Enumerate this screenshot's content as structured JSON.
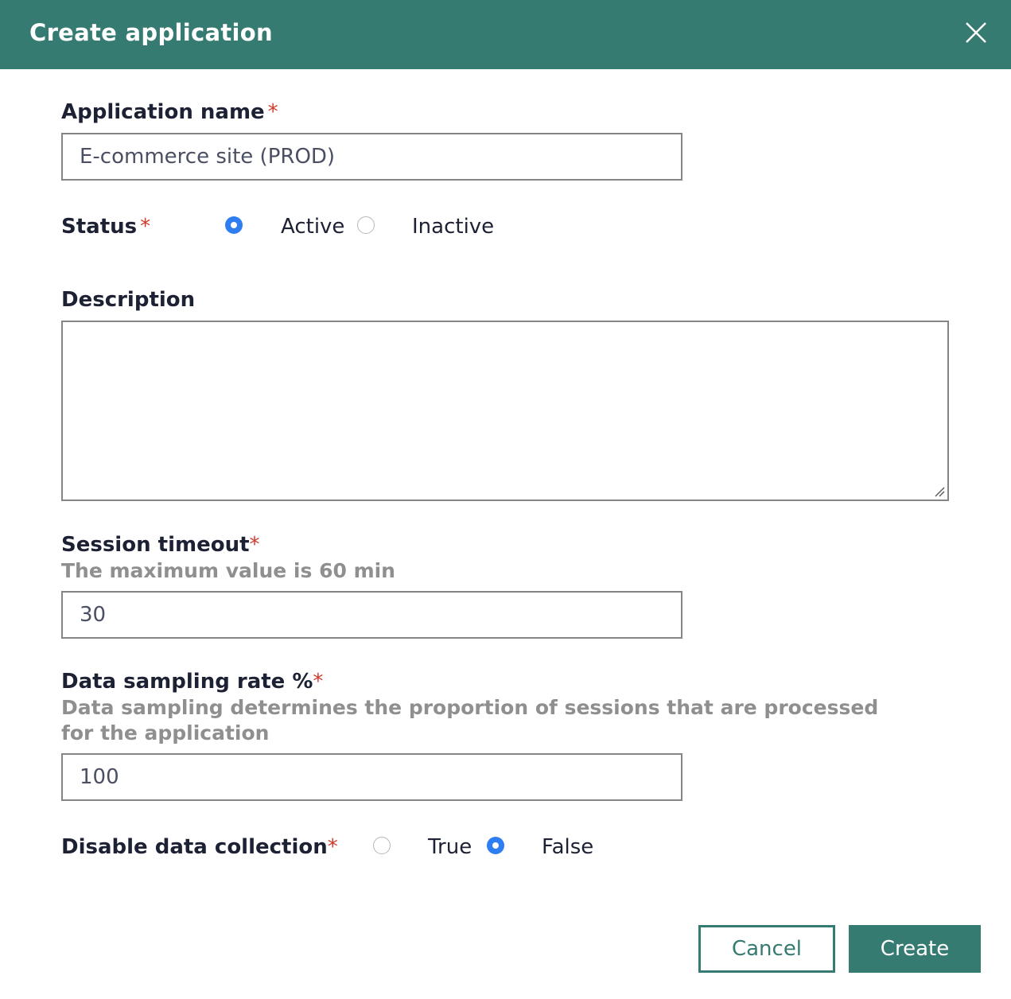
{
  "dialog": {
    "title": "Create application",
    "close_icon": "close-icon"
  },
  "colors": {
    "header": "#367b71",
    "required": "#d23a2a",
    "radio_selected": "#2e7df1",
    "hint": "#8f8f8f"
  },
  "fields": {
    "app_name": {
      "label": "Application name",
      "required_mark": "*",
      "value": "E-commerce site (PROD)"
    },
    "status": {
      "label": "Status",
      "required_mark": "*",
      "options": [
        {
          "label": "Active",
          "selected": true
        },
        {
          "label": "Inactive",
          "selected": false
        }
      ]
    },
    "description": {
      "label": "Description",
      "value": ""
    },
    "session_timeout": {
      "label": "Session timeout",
      "required_mark": "*",
      "hint": "The maximum value is 60 min",
      "value": "30"
    },
    "sampling_rate": {
      "label": "Data sampling rate %",
      "required_mark": "*",
      "hint": "Data sampling determines the proportion of sessions that are processed for the application",
      "value": "100"
    },
    "disable_collection": {
      "label": "Disable data collection",
      "required_mark": "*",
      "options": [
        {
          "label": "True",
          "selected": false
        },
        {
          "label": "False",
          "selected": true
        }
      ]
    }
  },
  "footer": {
    "cancel_label": "Cancel",
    "create_label": "Create"
  }
}
